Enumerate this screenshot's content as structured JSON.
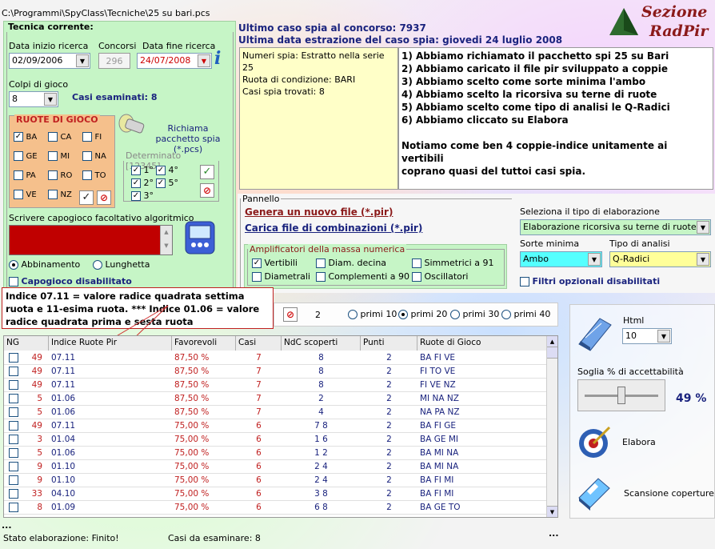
{
  "title_path": "C:\\Programmi\\SpyClass\\Tecniche\\25 su bari.pcs",
  "logo": {
    "line1": "Sezione",
    "line2": "RadPir"
  },
  "tecnica": {
    "title": "Tecnica corrente:",
    "data_inizio_label": "Data inizio ricerca",
    "data_inizio": "02/09/2006",
    "concorsi_label": "Concorsi",
    "concorsi": "296",
    "data_fine_label": "Data fine ricerca",
    "data_fine": "24/07/2008",
    "colpi_label": "Colpi di gioco",
    "colpi": "8",
    "casi_esaminati": "Casi esaminati: 8",
    "ruote_title": "RUOTE DI GIOCO",
    "ruote": [
      {
        "label": "BA",
        "checked": true
      },
      {
        "label": "CA",
        "checked": false
      },
      {
        "label": "FI",
        "checked": false
      },
      {
        "label": "GE",
        "checked": false
      },
      {
        "label": "MI",
        "checked": false
      },
      {
        "label": "NA",
        "checked": false
      },
      {
        "label": "PA",
        "checked": false
      },
      {
        "label": "RO",
        "checked": false
      },
      {
        "label": "TO",
        "checked": false
      },
      {
        "label": "VE",
        "checked": false
      },
      {
        "label": "NZ",
        "checked": false
      }
    ],
    "richiama_label": "Richiama pacchetto spia (*.pcs)",
    "determinato_label": "Determinato [12345]",
    "determinato": [
      {
        "label": "1°",
        "checked": true
      },
      {
        "label": "4°",
        "checked": true
      },
      {
        "label": "2°",
        "checked": true
      },
      {
        "label": "5°",
        "checked": true
      },
      {
        "label": "3°",
        "checked": true
      }
    ],
    "capogioco_label": "Scrivere capogioco facoltativo algoritmico",
    "abbinamento": "Abbinamento",
    "lunghetta": "Lunghetta",
    "capogioco_disabilitato": "Capogioco disabilitato"
  },
  "info": {
    "ultimo_caso": "Ultimo caso spia al concorso: 7937",
    "ultima_data": "Ultima data estrazione del caso spia: giovedi 24 luglio 2008",
    "left_lines": [
      "Numeri spia: Estratto nella serie 25",
      "Ruota di condizione: BARI",
      "Casi spia trovati: 8"
    ],
    "right_lines": [
      "1) Abbiamo richiamato il pacchetto spi 25 su Bari",
      "2) Abbiamo caricato il file pir sviluppato a coppie",
      "3) Abbiamo scelto come sorte minima l'ambo",
      "4) Abbiamo scelto la ricorsiva su terne di ruote",
      "5) Abbiamo scelto come tipo di analisi le Q-Radici",
      "6) Abbiamo cliccato su Elabora",
      "",
      "Notiamo come ben 4 coppie-indice unitamente ai vertibili",
      "coprano quasi del tuttoi casi spia."
    ]
  },
  "pannello": {
    "title": "Pannello",
    "genera": "Genera un nuovo file  (*.pir)",
    "carica": "Carica file di combinazioni  (*.pir)",
    "amplificatori_title": "Amplificatori della massa numerica",
    "amplificatori": [
      {
        "label": "Vertibili",
        "checked": true
      },
      {
        "label": "Diam. decina",
        "checked": false
      },
      {
        "label": "Simmetrici a 91",
        "checked": false
      },
      {
        "label": "Diametrali",
        "checked": false
      },
      {
        "label": "Complementi a 90",
        "checked": false
      },
      {
        "label": "Oscillatori",
        "checked": false
      }
    ],
    "tipo_elab_label": "Seleziona il tipo di elaborazione",
    "tipo_elab": "Elaborazione ricorsiva su terne di ruote",
    "sorte_label": "Sorte minima",
    "sorte": "Ambo",
    "analisi_label": "Tipo di analisi",
    "analisi": "Q-Radici",
    "filtri": "Filtri opzionali disabilitati"
  },
  "tooltip": "Indice 07.11 = valore radice quadrata settima ruota e 11-esima ruota.  *** Indice 01.06 = valore radice quadrata prima e sesta ruota",
  "filter": {
    "count": "2",
    "options": [
      {
        "label": "primi 10",
        "selected": false
      },
      {
        "label": "primi 20",
        "selected": true
      },
      {
        "label": "primi 30",
        "selected": false
      },
      {
        "label": "primi 40",
        "selected": false
      }
    ]
  },
  "table": {
    "headers": [
      "NG",
      "Indice Ruote Pir",
      "Favorevoli",
      "Casi",
      "NdC scoperti",
      "Punti",
      "Ruote di Gioco"
    ],
    "rows": [
      [
        "49",
        "07.11",
        "87,50 %",
        "7",
        "8",
        "2",
        "BA FI VE"
      ],
      [
        "49",
        "07.11",
        "87,50 %",
        "7",
        "8",
        "2",
        "FI TO VE"
      ],
      [
        "49",
        "07.11",
        "87,50 %",
        "7",
        "8",
        "2",
        "FI VE NZ"
      ],
      [
        "5",
        "01.06",
        "87,50 %",
        "7",
        "2",
        "2",
        "MI NA NZ"
      ],
      [
        "5",
        "01.06",
        "87,50 %",
        "7",
        "4",
        "2",
        "NA PA NZ"
      ],
      [
        "49",
        "07.11",
        "75,00 %",
        "6",
        "7 8",
        "2",
        "BA FI GE"
      ],
      [
        "3",
        "01.04",
        "75,00 %",
        "6",
        "1 6",
        "2",
        "BA GE MI"
      ],
      [
        "5",
        "01.06",
        "75,00 %",
        "6",
        "1 2",
        "2",
        "BA MI NA"
      ],
      [
        "9",
        "01.10",
        "75,00 %",
        "6",
        "2 4",
        "2",
        "BA MI NA"
      ],
      [
        "9",
        "01.10",
        "75,00 %",
        "6",
        "2 4",
        "2",
        "BA FI MI"
      ],
      [
        "33",
        "04.10",
        "75,00 %",
        "6",
        "3 8",
        "2",
        "BA FI MI"
      ],
      [
        "8",
        "01.09",
        "75,00 %",
        "6",
        "6 8",
        "2",
        "BA GE TO"
      ]
    ]
  },
  "right_panel": {
    "html_label": "Html",
    "html_value": "10",
    "soglia_label": "Soglia % di accettabilità",
    "soglia_value": "49 %",
    "soglia_fraction": 0.49,
    "elabora": "Elabora",
    "scansione": "Scansione coperture"
  },
  "status": {
    "dots_left": "...",
    "stato": "Stato elaborazione: Finito!",
    "casi": "Casi da esaminare: 8",
    "dots_right": "..."
  }
}
